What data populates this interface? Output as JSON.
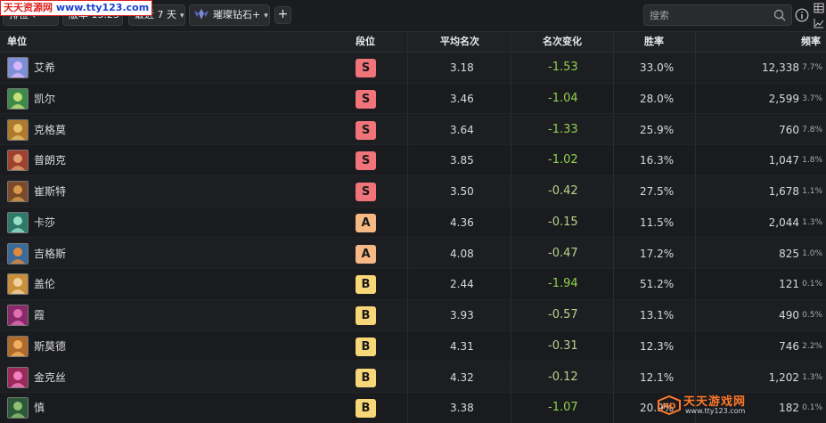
{
  "watermark_top": {
    "brand": "天天资源网",
    "url": "www.tty123.com"
  },
  "watermark_bottom": {
    "brand": "天天游戏网",
    "url": "www.tty123.com"
  },
  "toolbar": {
    "filter1_label": "排位",
    "filter2_label": "版本 13.23",
    "time_label": "最近 7 天",
    "rank_label": "璀璨钻石+",
    "add_label": "+",
    "search_placeholder": "搜索"
  },
  "columns": {
    "unit": "单位",
    "tier": "段位",
    "avg_place": "平均名次",
    "place_change": "名次变化",
    "win_rate": "胜率",
    "frequency": "频率"
  },
  "colors": {
    "tier_S": "#f07479",
    "tier_A": "#f6b985",
    "tier_B": "#f8d778",
    "delta_green": "#8fd14f"
  },
  "rows": [
    {
      "name": "艾希",
      "tier": "S",
      "avg": "3.18",
      "delta": "-1.53",
      "win": "33.0%",
      "freq": "12,338",
      "pct": "7.7%",
      "portrait": "#7d8fd6",
      "portrait2": "#d8b6ff"
    },
    {
      "name": "凯尔",
      "tier": "S",
      "avg": "3.46",
      "delta": "-1.04",
      "win": "28.0%",
      "freq": "2,599",
      "pct": "3.7%",
      "portrait": "#3d8a4a",
      "portrait2": "#c8e07a"
    },
    {
      "name": "克格莫",
      "tier": "S",
      "avg": "3.64",
      "delta": "-1.33",
      "win": "25.9%",
      "freq": "760",
      "pct": "7.8%",
      "portrait": "#b07a2e",
      "portrait2": "#e6c26a"
    },
    {
      "name": "普朗克",
      "tier": "S",
      "avg": "3.85",
      "delta": "-1.02",
      "win": "16.3%",
      "freq": "1,047",
      "pct": "1.8%",
      "portrait": "#a0402e",
      "portrait2": "#e0a070"
    },
    {
      "name": "崔斯特",
      "tier": "S",
      "avg": "3.50",
      "delta": "-0.42",
      "win": "27.5%",
      "freq": "1,678",
      "pct": "1.1%",
      "portrait": "#7a4a2a",
      "portrait2": "#d79a4a"
    },
    {
      "name": "卡莎",
      "tier": "A",
      "avg": "4.36",
      "delta": "-0.15",
      "win": "11.5%",
      "freq": "2,044",
      "pct": "1.3%",
      "portrait": "#2e7a6a",
      "portrait2": "#9ae0c8"
    },
    {
      "name": "吉格斯",
      "tier": "A",
      "avg": "4.08",
      "delta": "-0.47",
      "win": "17.2%",
      "freq": "825",
      "pct": "1.0%",
      "portrait": "#3a6a9a",
      "portrait2": "#e08a3a"
    },
    {
      "name": "盖伦",
      "tier": "B",
      "avg": "2.44",
      "delta": "-1.94",
      "win": "51.2%",
      "freq": "121",
      "pct": "0.1%",
      "portrait": "#c8903a",
      "portrait2": "#f0d0a0"
    },
    {
      "name": "霞",
      "tier": "B",
      "avg": "3.93",
      "delta": "-0.57",
      "win": "13.1%",
      "freq": "490",
      "pct": "0.5%",
      "portrait": "#8a2a6a",
      "portrait2": "#e070b0"
    },
    {
      "name": "斯莫德",
      "tier": "B",
      "avg": "4.31",
      "delta": "-0.31",
      "win": "12.3%",
      "freq": "746",
      "pct": "2.2%",
      "portrait": "#b06a2a",
      "portrait2": "#f0b060"
    },
    {
      "name": "金克丝",
      "tier": "B",
      "avg": "4.32",
      "delta": "-0.12",
      "win": "12.1%",
      "freq": "1,202",
      "pct": "1.3%",
      "portrait": "#9a2a5a",
      "portrait2": "#f080c0"
    },
    {
      "name": "慎",
      "tier": "B",
      "avg": "3.38",
      "delta": "-1.07",
      "win": "20.9%",
      "freq": "182",
      "pct": "0.1%",
      "portrait": "#2a5a3a",
      "portrait2": "#90c070"
    }
  ]
}
